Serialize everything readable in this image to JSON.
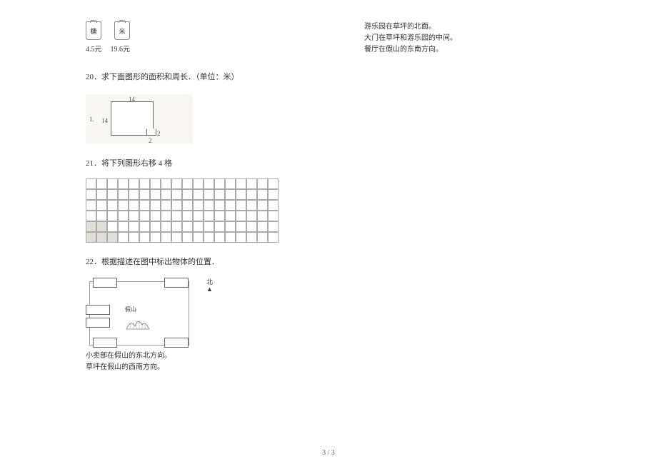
{
  "products": {
    "item1_label": "糖",
    "item2_label": "米",
    "price1": "4.5元",
    "price2": "19.6元"
  },
  "q20": {
    "title": "20．求下面图形的面积和周长．（单位：米）",
    "subfig": "1.",
    "dim_top": "14",
    "dim_left": "14",
    "dim_notch_a": "2",
    "dim_notch_b": "2"
  },
  "q21": {
    "title": "21．将下列图形右移 4 格"
  },
  "q22": {
    "title": "22．根据描述在图中标出物体的位置．",
    "hill_label": "假山",
    "north": "北",
    "north_arrow": "▲",
    "lines_left": [
      "小卖部在假山的东北方向。",
      "草坪在假山的西南方向。"
    ],
    "lines_right": [
      "游乐园在草坪的北面。",
      "大门在草坪和游乐园的中间。",
      "餐厅在假山的东南方向。"
    ]
  },
  "page_number": "3 / 3"
}
